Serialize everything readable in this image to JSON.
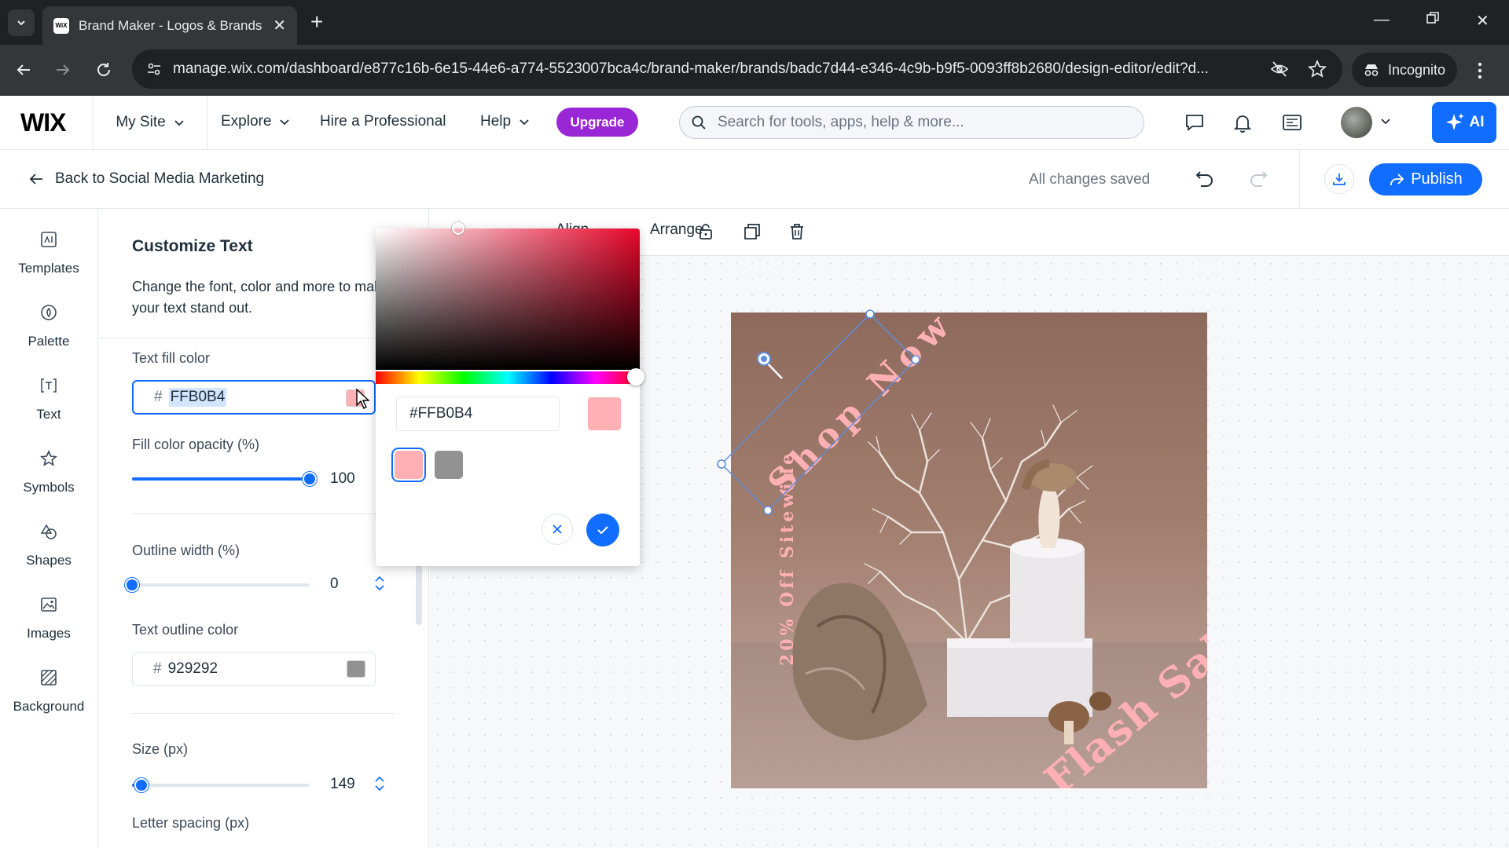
{
  "browser": {
    "tab_title": "Brand Maker - Logos & Brands",
    "url": "manage.wix.com/dashboard/e877c16b-6e15-44e6-a774-5523007bca4c/brand-maker/brands/badc7d44-e346-4c9b-b9f5-0093ff8b2680/design-editor/edit?d...",
    "incognito_label": "Incognito",
    "favicon_text": "WiX"
  },
  "topbar": {
    "logo": "WIX",
    "my_site": "My Site",
    "explore": "Explore",
    "hire": "Hire a Professional",
    "help": "Help",
    "upgrade": "Upgrade",
    "search_placeholder": "Search for tools, apps, help & more...",
    "ai_label": "AI",
    "upgrade_color": "#9a27d5",
    "accent_color": "#116dff"
  },
  "subbar": {
    "back_label": "Back to Social Media Marketing",
    "status": "All changes saved",
    "publish": "Publish"
  },
  "rail": {
    "items": [
      {
        "label": "Templates",
        "icon": "templates-icon"
      },
      {
        "label": "Palette",
        "icon": "palette-icon"
      },
      {
        "label": "Text",
        "icon": "text-icon"
      },
      {
        "label": "Symbols",
        "icon": "star-icon"
      },
      {
        "label": "Shapes",
        "icon": "shapes-icon"
      },
      {
        "label": "Images",
        "icon": "image-icon"
      },
      {
        "label": "Background",
        "icon": "background-icon"
      }
    ]
  },
  "panel": {
    "title": "Customize Text",
    "description": "Change the font, color and more to make your text stand out.",
    "fill_color_label": "Text fill color",
    "fill_color_value": "FFB0B4",
    "fill_color_hex": "#FFB0B4",
    "opacity_label": "Fill color opacity (%)",
    "opacity_value": "100",
    "outline_width_label": "Outline width (%)",
    "outline_width_value": "0",
    "outline_color_label": "Text outline color",
    "outline_color_value": "929292",
    "outline_color_hex": "#929292",
    "size_label": "Size (px)",
    "size_value": "149",
    "letter_spacing_label": "Letter spacing (px)"
  },
  "toolbar": {
    "align_label": "Align",
    "arrange_label": "Arrange"
  },
  "design": {
    "shop_now": "Shop Now",
    "discount": "20% Off Sitewide",
    "flash_sale": "Flash Sale",
    "text_color": "#ffb0b4"
  },
  "picker": {
    "hex_value": "#FFB0B4",
    "preview_color": "#ffb0b4",
    "swatches": [
      "#ffb0b4",
      "#929292"
    ]
  }
}
